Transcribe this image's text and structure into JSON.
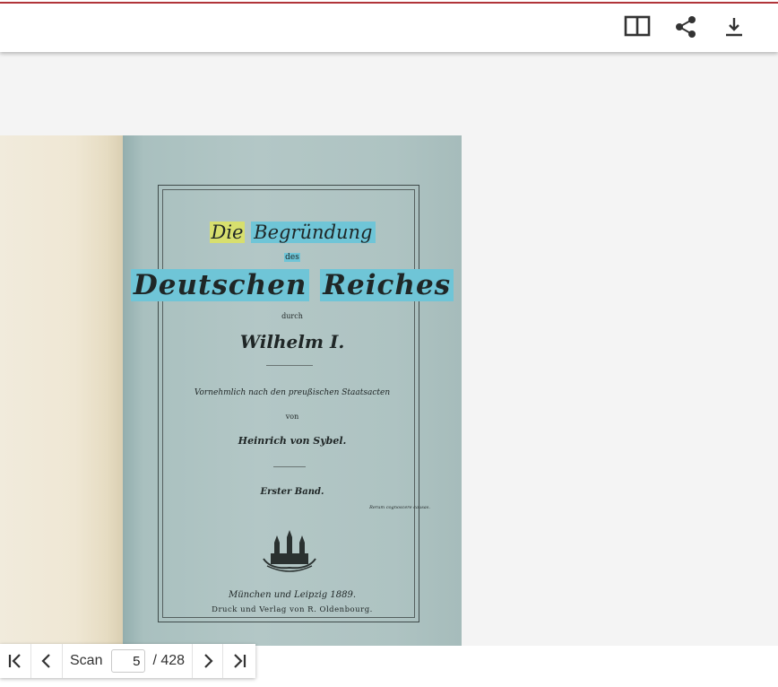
{
  "toolbar": {
    "icons": [
      "book-view-icon",
      "share-icon",
      "download-icon"
    ]
  },
  "scan_page": {
    "title_line1_a": "Die",
    "title_line1_b": "Begründung",
    "title_line2": "des",
    "title_line3_a": "Deutschen",
    "title_line3_b": "Reiches",
    "title_line4": "durch",
    "title_line5": "Wilhelm I.",
    "subtitle": "Vornehmlich nach den preußischen Staatsacten",
    "by": "von",
    "author": "Heinrich von Sybel.",
    "volume": "Erster Band.",
    "motto": "Rerum cognoscere causas.",
    "place": "München und Leipzig 1889.",
    "publisher": "Druck und Verlag von R. Oldenbourg."
  },
  "navigation": {
    "scan_label": "Scan",
    "current_page": "5",
    "total_pages": "/ 428",
    "icons": [
      "first-page-icon",
      "previous-page-icon",
      "next-page-icon",
      "last-page-icon"
    ]
  },
  "colors": {
    "accent": "#b5353a",
    "highlight_yellow": "#d7df6e",
    "highlight_cyan": "#6fc5d7"
  }
}
